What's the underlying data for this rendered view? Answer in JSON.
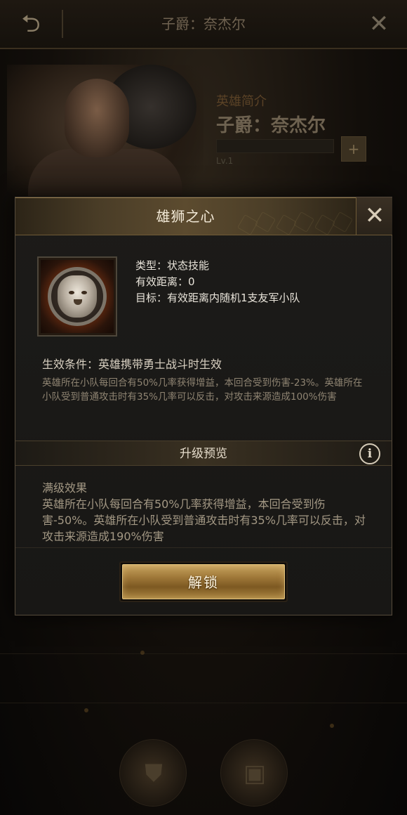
{
  "background": {
    "topbar_title": "子爵：奈杰尔",
    "hero_subtitle": "英雄简介",
    "hero_name": "子爵：奈杰尔",
    "hero_level": "Lv.1",
    "hero_plus": "+"
  },
  "dialog": {
    "title": "雄狮之心",
    "skill": {
      "type_label": "类型：状态技能",
      "range_label": "有效距离：0",
      "target_label": "目标：有效距离内随机1支友军小队"
    },
    "condition": "生效条件：英雄携带勇士战斗时生效",
    "description": "英雄所在小队每回合有50%几率获得增益，本回合受到伤害-23%。英雄所在小队受到普通攻击时有35%几率可以反击，对攻击来源造成100%伤害",
    "preview_title": "升级预览",
    "info_symbol": "i",
    "max_level_title": "满级效果",
    "max_level_text": "英雄所在小队每回合有50%几率获得增益，本回合受到伤害-50%。英雄所在小队受到普通攻击时有35%几率可以反击，对攻击来源造成190%伤害",
    "unlock_label": "解锁"
  },
  "icons": {
    "back": "back-arrow-icon",
    "close": "close-icon",
    "info": "info-icon",
    "skill": "lion-emblem-icon"
  },
  "colors": {
    "accent_gold": "#a17a3a",
    "title_text": "#f3ead8",
    "dialog_bg": "#1c1b19"
  }
}
